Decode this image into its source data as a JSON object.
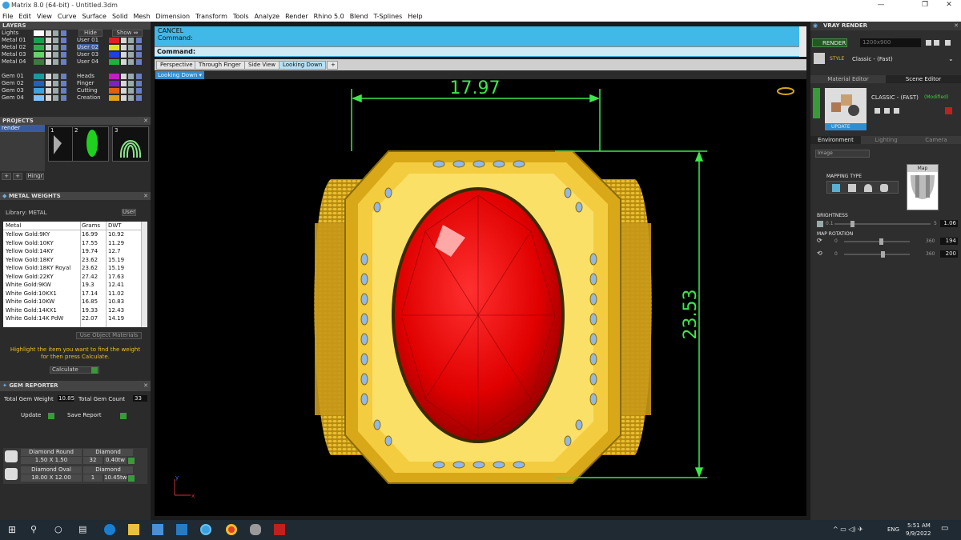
{
  "app": {
    "title": "Matrix 8.0 (64-bit) - Untitled.3dm"
  },
  "menu": [
    "File",
    "Edit",
    "View",
    "Curve",
    "Surface",
    "Solid",
    "Mesh",
    "Dimension",
    "Transform",
    "Tools",
    "Analyze",
    "Render",
    "Rhino 5.0",
    "Blend",
    "T-Splines",
    "Help"
  ],
  "layers": {
    "title": "LAYERS",
    "hide_label": "Hide",
    "show_label": "Show",
    "left": [
      {
        "name": "Lights",
        "color": "#ffffff"
      },
      {
        "name": "Metal 01",
        "color": "#17a050"
      },
      {
        "name": "Metal 02",
        "color": "#2ab04a"
      },
      {
        "name": "Metal 03",
        "color": "#6ad06a"
      },
      {
        "name": "Metal 04",
        "color": "#3d7a3d"
      },
      {
        "name": "Gem 01",
        "color": "#1a9a9a"
      },
      {
        "name": "Gem 02",
        "color": "#2060c0"
      },
      {
        "name": "Gem 03",
        "color": "#40a0e0"
      },
      {
        "name": "Gem 04",
        "color": "#80c0ff"
      }
    ],
    "right": [
      {
        "name": "User 01",
        "color": "#e02020"
      },
      {
        "name": "User 02",
        "color": "#e0e020"
      },
      {
        "name": "User 03",
        "color": "#2040e0"
      },
      {
        "name": "User 04",
        "color": "#20b040"
      },
      {
        "name": "Heads",
        "color": "#c020c0"
      },
      {
        "name": "Finger",
        "color": "#8020c0"
      },
      {
        "name": "Cutting",
        "color": "#e06010"
      },
      {
        "name": "Creation",
        "color": "#e0a020"
      }
    ]
  },
  "projects": {
    "title": "PROJECTS",
    "item": "render",
    "thumbs": [
      "1",
      "2",
      "3"
    ],
    "hinge": "Hingr"
  },
  "metal": {
    "title": "METAL WEIGHTS",
    "library": "Library: METAL",
    "user_btn": "User",
    "headers": [
      "Metal",
      "Grams",
      "DWT"
    ],
    "rows": [
      [
        "Yellow Gold:9KY",
        "16.99",
        "10.92"
      ],
      [
        "Yellow Gold:10KY",
        "17.55",
        "11.29"
      ],
      [
        "Yellow Gold:14KY",
        "19.74",
        "12.7"
      ],
      [
        "Yellow Gold:18KY",
        "23.62",
        "15.19"
      ],
      [
        "Yellow Gold:18KY Royal",
        "23.62",
        "15.19"
      ],
      [
        "Yellow Gold:22KY",
        "27.42",
        "17.63"
      ],
      [
        "White Gold:9KW",
        "19.3",
        "12.41"
      ],
      [
        "White Gold:10KX1",
        "17.14",
        "11.02"
      ],
      [
        "White Gold:10KW",
        "16.85",
        "10.83"
      ],
      [
        "White Gold:14KX1",
        "19.33",
        "12.43"
      ],
      [
        "White Gold:14K PdW",
        "22.07",
        "14.19"
      ]
    ],
    "use_object": "Use Object Materials",
    "hint": "Highlight the item you want to find the weight for then press Calculate.",
    "calculate": "Calculate"
  },
  "gem": {
    "title": "GEM REPORTER",
    "total_weight_label": "Total Gem Weight",
    "total_weight": "10.85",
    "total_count_label": "Total Gem Count",
    "total_count": "33",
    "update": "Update",
    "save": "Save Report",
    "items": [
      {
        "shape": "Diamond Round",
        "size": "1.50 X 1.50",
        "type": "Diamond",
        "count": "32",
        "weight": "0.40tw"
      },
      {
        "shape": "Diamond Oval",
        "size": "18.00 X 12.00",
        "type": "Diamond",
        "count": "1",
        "weight": "10.45tw"
      }
    ]
  },
  "command": {
    "line1": "CANCEL",
    "line2": "Command:",
    "prompt": "Command:"
  },
  "tabs": [
    "Perspective",
    "Through Finger",
    "Side View",
    "Looking Down"
  ],
  "viewport": {
    "name": "Looking Down",
    "dim_width": "17.97",
    "dim_height": "23.53",
    "axis_y": "y",
    "axis_x": "x"
  },
  "vray": {
    "title": "VRAY RENDER",
    "render_btn": "RENDER",
    "resolution": "1200x900",
    "style_label": "STYLE",
    "style_value": "Classic - (Fast)",
    "tabs": [
      "Material Editor",
      "Scene Editor"
    ],
    "scene_name": "CLASSIC - (FAST)",
    "modified": "(Modified)",
    "update": "UPDATE",
    "env_tabs": [
      "Environment",
      "Lighting",
      "Camera"
    ],
    "bg_type": "Image",
    "mapping_type": "MAPPING TYPE",
    "map_label": "Map",
    "brightness_label": "BRIGHTNESS",
    "brightness_min": "0.1",
    "brightness_max": "5",
    "brightness_value": "1.06",
    "map_rotation_label": "MAP ROTATION",
    "rot1_min": "0",
    "rot1_max": "360",
    "rot1_value": "194",
    "rot2_min": "0",
    "rot2_max": "360",
    "rot2_value": "200"
  },
  "taskbar": {
    "lang": "ENG",
    "time": "5:51 AM",
    "date": "9/9/2022"
  },
  "colors": {
    "cmd_bg": "#40b8e8",
    "dim_green": "#3ce84a",
    "gold": "#e0b010",
    "ruby": "#e01010",
    "gem_blue": "#90b8e8"
  }
}
